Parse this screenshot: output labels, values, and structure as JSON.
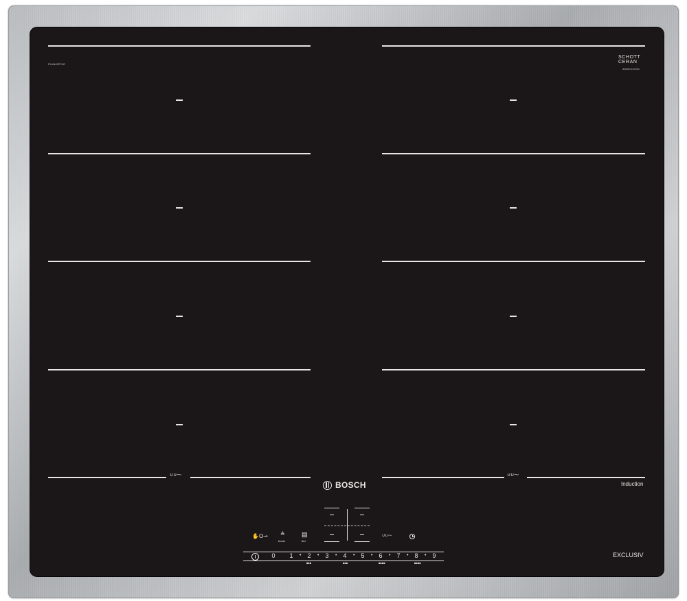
{
  "brand": {
    "name": "BOSCH",
    "glass_brand_line1": "SCHOTT",
    "glass_brand_line2": "CERAN",
    "product_type": "Induction",
    "series": "EXCLUSIV"
  },
  "small_print": {
    "left_code": "PXX645FC1E",
    "right_code": "9000XXXXXX"
  },
  "zones": {
    "left": [
      "zone-1",
      "zone-2",
      "zone-3",
      "zone-4"
    ],
    "right": [
      "zone-5",
      "zone-6",
      "zone-7",
      "zone-8"
    ]
  },
  "controls": {
    "power_symbol": "I",
    "childlock_icon": "✋O⊸",
    "boost_icon": "≙",
    "boost_label": "boost",
    "flex_icon": "▤",
    "flex_label": "flex",
    "bridge_icon_symbol": "∪∪⁓",
    "display_dash": "–",
    "slider_numbers": [
      "0",
      "1",
      "2",
      "3",
      "4",
      "5",
      "6",
      "7",
      "8",
      "9"
    ],
    "slider_dot": "•",
    "slider_sublabels": [
      "■■■",
      "■■■",
      "■■■■",
      "■■■■"
    ]
  },
  "colors": {
    "glass": "#1b1718",
    "print": "#e8e6e4",
    "frame": "#b9bcbf"
  }
}
